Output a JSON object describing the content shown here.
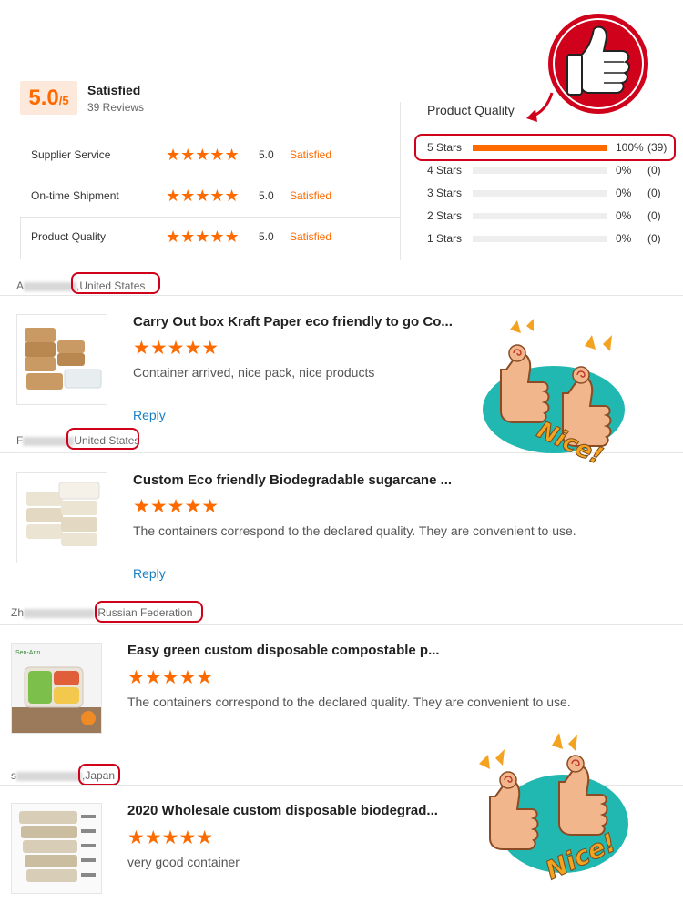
{
  "summary": {
    "score": "5.0",
    "score_denominator": "/5",
    "title": "Satisfied",
    "reviews_count": "39 Reviews"
  },
  "metrics": [
    {
      "label": "Supplier Service",
      "stars": "★★★★★",
      "value": "5.0",
      "status": "Satisfied"
    },
    {
      "label": "On-time Shipment",
      "stars": "★★★★★",
      "value": "5.0",
      "status": "Satisfied"
    },
    {
      "label": "Product Quality",
      "stars": "★★★★★",
      "value": "5.0",
      "status": "Satisfied"
    }
  ],
  "distribution": {
    "heading": "Product Quality",
    "rows": [
      {
        "label": "5 Stars",
        "fraction": 1.0,
        "percent": "100%",
        "count": "(39)"
      },
      {
        "label": "4 Stars",
        "fraction": 0.0,
        "percent": "0%",
        "count": "(0)"
      },
      {
        "label": "3 Stars",
        "fraction": 0.0,
        "percent": "0%",
        "count": "(0)"
      },
      {
        "label": "2 Stars",
        "fraction": 0.0,
        "percent": "0%",
        "count": "(0)"
      },
      {
        "label": "1 Stars",
        "fraction": 0.0,
        "percent": "0%",
        "count": "(0)"
      }
    ]
  },
  "reviews": [
    {
      "initial": "A",
      "country": ",United States",
      "product": "Carry Out box Kraft Paper eco friendly to go Co...",
      "stars": "★★★★★",
      "text": "Container arrived, nice pack, nice products",
      "reply": "Reply"
    },
    {
      "initial": "F",
      "country": "United States",
      "product": "Custom Eco friendly Biodegradable sugarcane ...",
      "stars": "★★★★★",
      "text": "The containers correspond to the declared quality. They are convenient to use.",
      "reply": "Reply"
    },
    {
      "initial": "Zh",
      "country": ",Russian Federation",
      "product": "Easy green custom disposable compostable p...",
      "stars": "★★★★★",
      "text": "The containers correspond to the declared quality. They are convenient to use."
    },
    {
      "initial": "s",
      "country": ",Japan",
      "product": "2020 Wholesale custom disposable biodegrad...",
      "stars": "★★★★★",
      "text": "very good container"
    }
  ],
  "stickers": {
    "nice_text": "Nice!"
  },
  "colors": {
    "accent": "#ff6a00",
    "highlight_red": "#d0021b",
    "link": "#1a7fc1"
  },
  "icons": [
    "thumbs-up-badge-icon",
    "nice-sticker-icon",
    "star-icon"
  ]
}
